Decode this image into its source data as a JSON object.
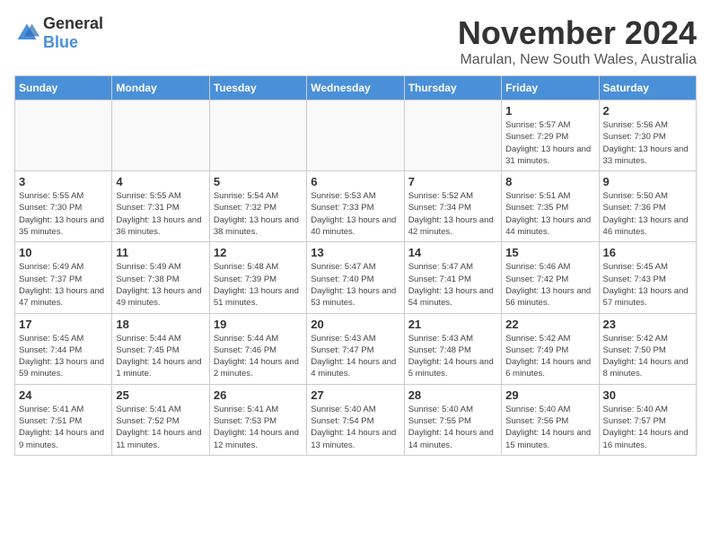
{
  "logo": {
    "general": "General",
    "blue": "Blue"
  },
  "title": {
    "month": "November 2024",
    "location": "Marulan, New South Wales, Australia"
  },
  "headers": [
    "Sunday",
    "Monday",
    "Tuesday",
    "Wednesday",
    "Thursday",
    "Friday",
    "Saturday"
  ],
  "weeks": [
    [
      {
        "day": "",
        "info": ""
      },
      {
        "day": "",
        "info": ""
      },
      {
        "day": "",
        "info": ""
      },
      {
        "day": "",
        "info": ""
      },
      {
        "day": "",
        "info": ""
      },
      {
        "day": "1",
        "info": "Sunrise: 5:57 AM\nSunset: 7:29 PM\nDaylight: 13 hours\nand 31 minutes."
      },
      {
        "day": "2",
        "info": "Sunrise: 5:56 AM\nSunset: 7:30 PM\nDaylight: 13 hours\nand 33 minutes."
      }
    ],
    [
      {
        "day": "3",
        "info": "Sunrise: 5:55 AM\nSunset: 7:30 PM\nDaylight: 13 hours\nand 35 minutes."
      },
      {
        "day": "4",
        "info": "Sunrise: 5:55 AM\nSunset: 7:31 PM\nDaylight: 13 hours\nand 36 minutes."
      },
      {
        "day": "5",
        "info": "Sunrise: 5:54 AM\nSunset: 7:32 PM\nDaylight: 13 hours\nand 38 minutes."
      },
      {
        "day": "6",
        "info": "Sunrise: 5:53 AM\nSunset: 7:33 PM\nDaylight: 13 hours\nand 40 minutes."
      },
      {
        "day": "7",
        "info": "Sunrise: 5:52 AM\nSunset: 7:34 PM\nDaylight: 13 hours\nand 42 minutes."
      },
      {
        "day": "8",
        "info": "Sunrise: 5:51 AM\nSunset: 7:35 PM\nDaylight: 13 hours\nand 44 minutes."
      },
      {
        "day": "9",
        "info": "Sunrise: 5:50 AM\nSunset: 7:36 PM\nDaylight: 13 hours\nand 46 minutes."
      }
    ],
    [
      {
        "day": "10",
        "info": "Sunrise: 5:49 AM\nSunset: 7:37 PM\nDaylight: 13 hours\nand 47 minutes."
      },
      {
        "day": "11",
        "info": "Sunrise: 5:49 AM\nSunset: 7:38 PM\nDaylight: 13 hours\nand 49 minutes."
      },
      {
        "day": "12",
        "info": "Sunrise: 5:48 AM\nSunset: 7:39 PM\nDaylight: 13 hours\nand 51 minutes."
      },
      {
        "day": "13",
        "info": "Sunrise: 5:47 AM\nSunset: 7:40 PM\nDaylight: 13 hours\nand 53 minutes."
      },
      {
        "day": "14",
        "info": "Sunrise: 5:47 AM\nSunset: 7:41 PM\nDaylight: 13 hours\nand 54 minutes."
      },
      {
        "day": "15",
        "info": "Sunrise: 5:46 AM\nSunset: 7:42 PM\nDaylight: 13 hours\nand 56 minutes."
      },
      {
        "day": "16",
        "info": "Sunrise: 5:45 AM\nSunset: 7:43 PM\nDaylight: 13 hours\nand 57 minutes."
      }
    ],
    [
      {
        "day": "17",
        "info": "Sunrise: 5:45 AM\nSunset: 7:44 PM\nDaylight: 13 hours\nand 59 minutes."
      },
      {
        "day": "18",
        "info": "Sunrise: 5:44 AM\nSunset: 7:45 PM\nDaylight: 14 hours\nand 1 minute."
      },
      {
        "day": "19",
        "info": "Sunrise: 5:44 AM\nSunset: 7:46 PM\nDaylight: 14 hours\nand 2 minutes."
      },
      {
        "day": "20",
        "info": "Sunrise: 5:43 AM\nSunset: 7:47 PM\nDaylight: 14 hours\nand 4 minutes."
      },
      {
        "day": "21",
        "info": "Sunrise: 5:43 AM\nSunset: 7:48 PM\nDaylight: 14 hours\nand 5 minutes."
      },
      {
        "day": "22",
        "info": "Sunrise: 5:42 AM\nSunset: 7:49 PM\nDaylight: 14 hours\nand 6 minutes."
      },
      {
        "day": "23",
        "info": "Sunrise: 5:42 AM\nSunset: 7:50 PM\nDaylight: 14 hours\nand 8 minutes."
      }
    ],
    [
      {
        "day": "24",
        "info": "Sunrise: 5:41 AM\nSunset: 7:51 PM\nDaylight: 14 hours\nand 9 minutes."
      },
      {
        "day": "25",
        "info": "Sunrise: 5:41 AM\nSunset: 7:52 PM\nDaylight: 14 hours\nand 11 minutes."
      },
      {
        "day": "26",
        "info": "Sunrise: 5:41 AM\nSunset: 7:53 PM\nDaylight: 14 hours\nand 12 minutes."
      },
      {
        "day": "27",
        "info": "Sunrise: 5:40 AM\nSunset: 7:54 PM\nDaylight: 14 hours\nand 13 minutes."
      },
      {
        "day": "28",
        "info": "Sunrise: 5:40 AM\nSunset: 7:55 PM\nDaylight: 14 hours\nand 14 minutes."
      },
      {
        "day": "29",
        "info": "Sunrise: 5:40 AM\nSunset: 7:56 PM\nDaylight: 14 hours\nand 15 minutes."
      },
      {
        "day": "30",
        "info": "Sunrise: 5:40 AM\nSunset: 7:57 PM\nDaylight: 14 hours\nand 16 minutes."
      }
    ]
  ]
}
